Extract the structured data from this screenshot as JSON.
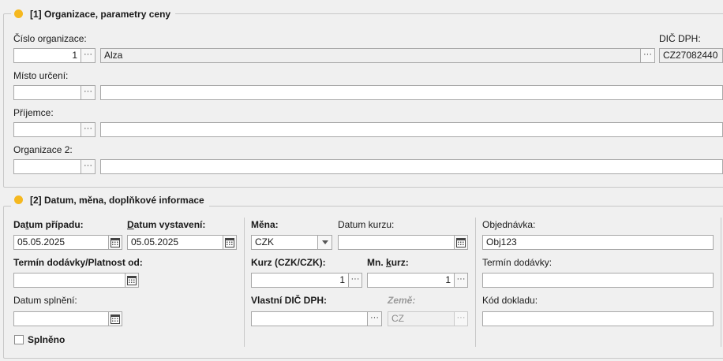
{
  "section1": {
    "title": "[1] Organizace, parametry ceny",
    "cislo_organizace": {
      "label": "Číslo organizace:",
      "code": "1",
      "name": "Alza"
    },
    "dic_dph": {
      "label": "DIČ DPH:",
      "value": "CZ27082440"
    },
    "misto_urceni": {
      "label": "Místo určení:",
      "code": "",
      "name": ""
    },
    "prijemce": {
      "label": "Příjemce:",
      "code": "",
      "name": ""
    },
    "organizace2": {
      "label": "Organizace 2:",
      "code": "",
      "name": ""
    },
    "ellipsis": "···"
  },
  "section2": {
    "title": "[2] Datum, měna, doplňkové informace",
    "datum_pripadu": {
      "label_pre": "Da",
      "label_u": "t",
      "label_post": "um případu:",
      "value": "05.05.2025"
    },
    "datum_vystaveni": {
      "label_pre": "",
      "label_u": "D",
      "label_post": "atum vystavení:",
      "value": "05.05.2025"
    },
    "termin_dodavky_platnost": {
      "label": "Termín dodávky/Platnost od:",
      "value": ""
    },
    "datum_splneni": {
      "label": "Datum splnění:",
      "value": ""
    },
    "splneno": {
      "label": "Splněno",
      "checked": false
    },
    "mena": {
      "label": "Měna:",
      "value": "CZK"
    },
    "datum_kurzu": {
      "label": "Datum kurzu:",
      "value": ""
    },
    "kurz": {
      "label": "Kurz (CZK/CZK):",
      "value": "1"
    },
    "mn_kurz": {
      "label_pre": "Mn. ",
      "label_u": "k",
      "label_post": "urz:",
      "value": "1"
    },
    "vlastni_dic": {
      "label": "Vlastní DIČ DPH:",
      "value": ""
    },
    "zeme": {
      "label": "Země:",
      "value": "CZ"
    },
    "objednavka": {
      "label": "Objednávka:",
      "value": "Obj123"
    },
    "termin_dodavky": {
      "label": "Termín dodávky:",
      "value": ""
    },
    "kod_dokladu": {
      "label": "Kód dokladu:",
      "value": ""
    },
    "ellipsis": "···"
  },
  "colors": {
    "accent_dot": "#f5b81f",
    "border": "#c8c8c8",
    "background": "#f0f0f0"
  },
  "icons": {
    "calendar": "calendar-icon",
    "dropdown": "chevron-down-icon",
    "ellipsis": "ellipsis-icon"
  }
}
